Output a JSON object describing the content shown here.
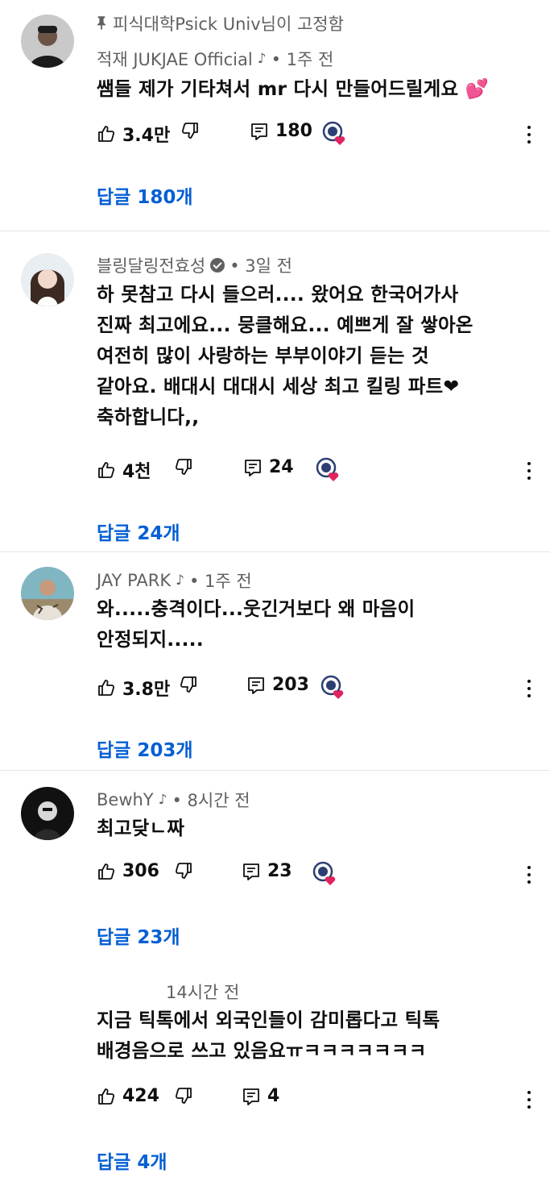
{
  "pinned_label": "피식대학Psick Univ님이 고정함",
  "comments": [
    {
      "author": "적재 JUKJAE Official",
      "time": "• 1주 전",
      "lines": [
        "쌤들 제가 기타쳐서 mr 다시 만들어드릴게요 💕"
      ],
      "likes": "3.4만",
      "reply_count": "180",
      "replies_label": "답글 180개"
    },
    {
      "author": "블링달링전효성",
      "time": "• 3일 전",
      "lines": [
        "하 못참고 다시 들으러.... 왔어요 한국어가사",
        "진짜 최고에요... 뭉클해요... 예쁘게 잘 쌓아온",
        "여전히 많이 사랑하는 부부이야기 듣는 것",
        "같아요. 배대시 대대시 세상 최고 킬링 파트❤",
        "축하합니다,,"
      ],
      "likes": "4천",
      "reply_count": "24",
      "replies_label": "답글 24개"
    },
    {
      "author": "JAY PARK",
      "time": "• 1주 전",
      "lines": [
        "와.....충격이다...웃긴거보다 왜 마음이",
        "안정되지....."
      ],
      "likes": "3.8만",
      "reply_count": "203",
      "replies_label": "답글 203개"
    },
    {
      "author": "BewhY",
      "time": "• 8시간 전",
      "lines": [
        "최고닺ㄴ짜"
      ],
      "likes": "306",
      "reply_count": "23",
      "replies_label": "답글 23개"
    },
    {
      "author": "",
      "time": "14시간 전",
      "lines": [
        "지금 틱톡에서 외국인들이 감미롭다고 틱톡",
        "배경음으로 쓰고 있음요ㅠㅋㅋㅋㅋㅋㅋㅋ"
      ],
      "likes": "424",
      "reply_count": "4",
      "replies_label": "답글 4개"
    }
  ],
  "icons": {
    "like": "thumbs-up-icon",
    "dislike": "thumbs-down-icon",
    "reply": "reply-icon",
    "creator_heart": "creator-heart-icon",
    "more": "more-vertical-icon",
    "note": "music-note-icon",
    "pin": "pin-icon",
    "verified": "verified-icon"
  },
  "colors": {
    "link": "#065fd4",
    "meta": "#606060",
    "heart": "#e0245e"
  }
}
